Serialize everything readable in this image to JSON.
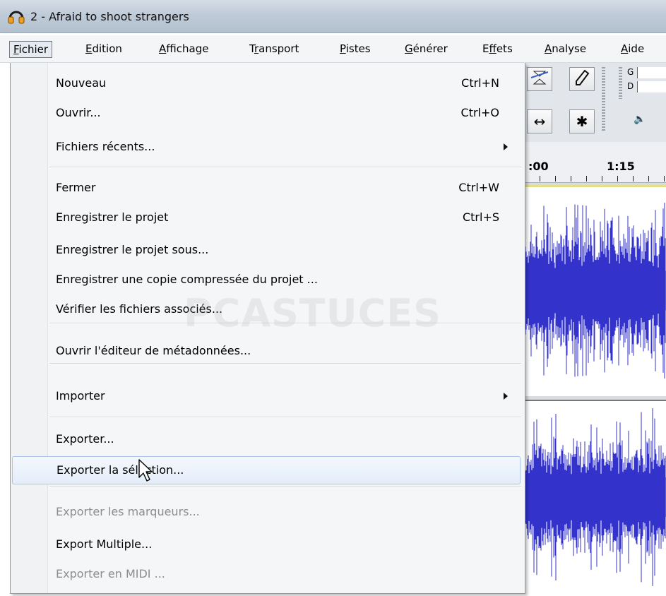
{
  "window": {
    "title": "2 - Afraid to shoot strangers",
    "icon": "headphones-icon",
    "accent": "#f0a020"
  },
  "menubar": [
    {
      "label": "Fichier",
      "mn": "F",
      "rest": "ichier",
      "active": true
    },
    {
      "label": "Edition",
      "mn": "E",
      "rest": "dition"
    },
    {
      "label": "Affichage",
      "mn": "A",
      "rest": "ffichage"
    },
    {
      "label": "Transport",
      "pre": "T",
      "mn": "r",
      "rest": "ansport"
    },
    {
      "label": "Pistes",
      "mn": "P",
      "rest": "istes"
    },
    {
      "label": "Générer",
      "mn": "G",
      "rest": "énérer"
    },
    {
      "label": "Effets",
      "pre": "E",
      "mn": "f",
      "rest": "fets"
    },
    {
      "label": "Analyse",
      "mn": "A",
      "rest": "nalyse"
    },
    {
      "label": "Aide",
      "mn": "A",
      "rest": "ide"
    }
  ],
  "menu": {
    "items": [
      {
        "label": "Nouveau",
        "shortcut": "Ctrl+N"
      },
      {
        "label": "Ouvrir...",
        "shortcut": "Ctrl+O"
      },
      {
        "label": "Fichiers récents...",
        "submenu": true
      },
      {
        "label": "Fermer",
        "shortcut": "Ctrl+W"
      },
      {
        "label": "Enregistrer le projet",
        "shortcut": "Ctrl+S"
      },
      {
        "label": "Enregistrer le projet sous..."
      },
      {
        "label": "Enregistrer une copie compressée du projet ..."
      },
      {
        "label": "Vérifier les fichiers associés..."
      },
      {
        "label": "Ouvrir l'éditeur de métadonnées..."
      },
      {
        "label": "Importer",
        "submenu": true
      },
      {
        "label": "Exporter..."
      },
      {
        "label": "Exporter la sélection...",
        "highlighted": true
      },
      {
        "label": "Exporter les marqueurs...",
        "disabled": true
      },
      {
        "label": "Export Multiple..."
      },
      {
        "label": "Exporter en MIDI ...",
        "disabled": true
      }
    ]
  },
  "toolbar": {
    "meter_g": "G",
    "meter_d": "D"
  },
  "ruler": {
    "label1": ":00",
    "label2": "1:15"
  },
  "watermark": "PCASTUCES",
  "colors": {
    "waveform": "#3333cc",
    "highlight": "#e3edf9"
  }
}
